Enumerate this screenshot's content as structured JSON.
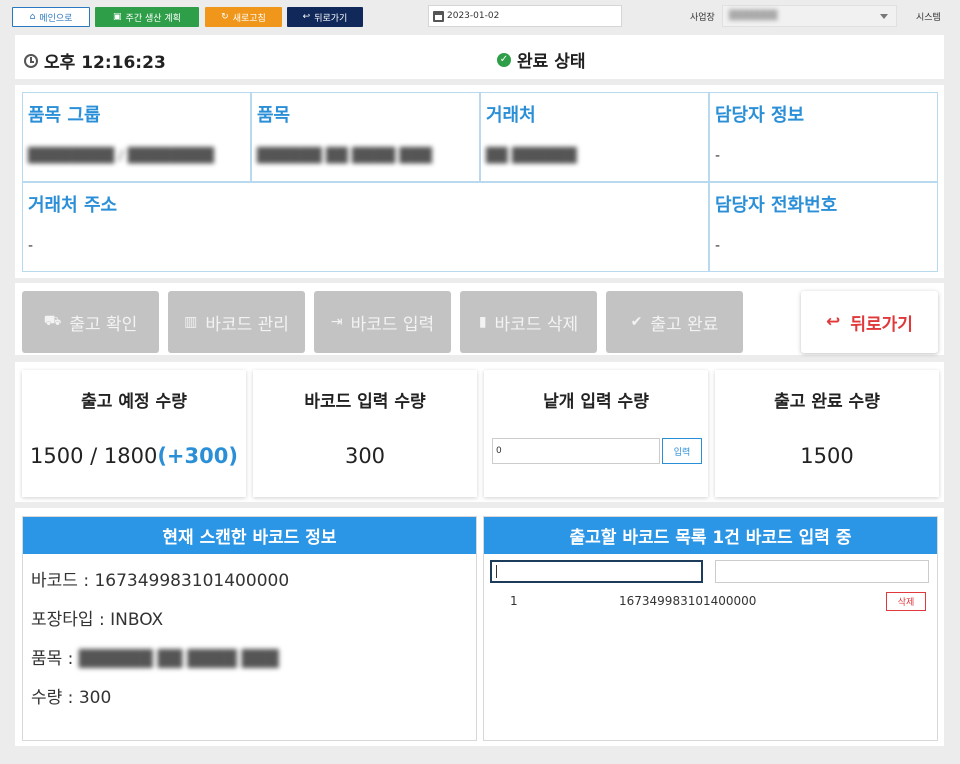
{
  "topbar": {
    "main_label": "메인으로",
    "weekly_label": "주간 생산 계획",
    "refresh_label": "새로고침",
    "back_label": "뒤로가기",
    "date": "2023-01-02",
    "site_label": "사업장",
    "site_value": "",
    "system_label": "시스템"
  },
  "status": {
    "time": "오후 12:16:23",
    "state": "완료 상태"
  },
  "info": {
    "item_group_label": "품목 그룹",
    "item_group_value": "",
    "item_label": "품목",
    "item_value": "",
    "vendor_label": "거래처",
    "vendor_value": "",
    "manager_label": "담당자 정보",
    "manager_value": "-",
    "vendor_address_label": "거래처 주소",
    "vendor_address_value": "-",
    "manager_phone_label": "담당자 전화번호",
    "manager_phone_value": "-"
  },
  "actions": {
    "ship_confirm": "출고 확인",
    "barcode_manage": "바코드 관리",
    "barcode_input": "바코드 입력",
    "barcode_delete": "바코드 삭제",
    "ship_complete": "출고 완료",
    "back": "뒤로가기"
  },
  "quantities": {
    "planned_label": "출고 예정 수량",
    "planned_value": "1500 / 1800",
    "planned_extra": "(+300)",
    "barcode_label": "바코드 입력 수량",
    "barcode_value": "300",
    "piece_label": "낱개 입력 수량",
    "piece_input_value": "0",
    "piece_button": "입력",
    "completed_label": "출고 완료 수량",
    "completed_value": "1500"
  },
  "scan": {
    "title": "현재 스캔한 바코드 정보",
    "barcode_line": "바코드 : 167349983101400000",
    "packing_line": "포장타입 : INBOX",
    "item_prefix": "품목 :",
    "quantity_line": "수량 : 300"
  },
  "shiplist": {
    "title": "출고할 바코드 목록 1건 바코드 입력 중",
    "rows": [
      {
        "no": "1",
        "barcode": "167349983101400000",
        "delete_label": "삭제"
      }
    ]
  },
  "colors": {
    "accent_blue": "#2b8fd8",
    "header_blue": "#2b95e6",
    "green": "#2e9e49",
    "orange": "#f0961a",
    "navy": "#11285a",
    "red": "#e0393b",
    "disabled_gray": "#c3c3c3"
  },
  "icons": {
    "main": "home-icon",
    "weekly": "calendar-icon",
    "refresh": "refresh-icon",
    "back": "return-arrow-icon",
    "clock": "clock-icon",
    "done": "check-circle-icon",
    "ship_confirm": "truck-icon",
    "barcode_manage": "barcode-icon",
    "barcode_input": "sign-in-icon",
    "barcode_delete": "trash-icon",
    "ship_complete": "check-circle-icon"
  }
}
